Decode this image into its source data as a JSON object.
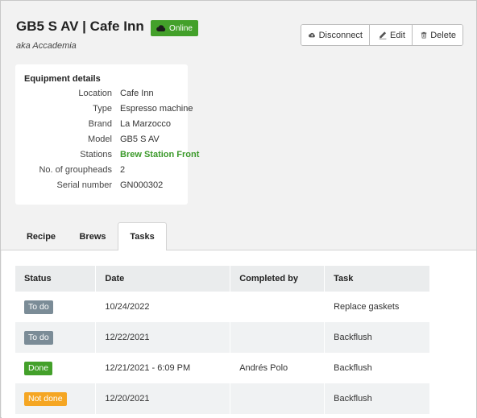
{
  "header": {
    "title": "GB5 S AV | Cafe Inn",
    "status": "Online",
    "aka": "aka Accademia",
    "actions": {
      "disconnect": "Disconnect",
      "edit": "Edit",
      "delete": "Delete"
    }
  },
  "equipment": {
    "title": "Equipment details",
    "rows": [
      {
        "label": "Location",
        "value": "Cafe Inn"
      },
      {
        "label": "Type",
        "value": "Espresso machine"
      },
      {
        "label": "Brand",
        "value": "La Marzocco"
      },
      {
        "label": "Model",
        "value": "GB5 S AV"
      },
      {
        "label": "Stations",
        "value": "Brew Station Front"
      },
      {
        "label": "No. of groupheads",
        "value": "2"
      },
      {
        "label": "Serial number",
        "value": "GN000302"
      }
    ]
  },
  "tabs": [
    {
      "label": "Recipe"
    },
    {
      "label": "Brews"
    },
    {
      "label": "Tasks",
      "active": true
    }
  ],
  "tasks_table": {
    "headers": [
      "Status",
      "Date",
      "Completed by",
      "Task"
    ],
    "rows": [
      {
        "status": "To do",
        "date": "10/24/2022",
        "completed_by": "",
        "task": "Replace gaskets"
      },
      {
        "status": "To do",
        "date": "12/22/2021",
        "completed_by": "",
        "task": "Backflush"
      },
      {
        "status": "Done",
        "date": "12/21/2021 - 6:09 PM",
        "completed_by": "Andrés Polo",
        "task": "Backflush"
      },
      {
        "status": "Not done",
        "date": "12/20/2021",
        "completed_by": "",
        "task": "Backflush"
      }
    ]
  },
  "colors": {
    "online": "#43a02a",
    "todo": "#7b8c97",
    "done": "#43a02a",
    "not_done": "#f5a623",
    "link": "#3c9a2b"
  },
  "icons": {
    "online": "cloud-icon",
    "disconnect": "cloud-icon",
    "edit": "pencil-icon",
    "delete": "trash-icon"
  }
}
